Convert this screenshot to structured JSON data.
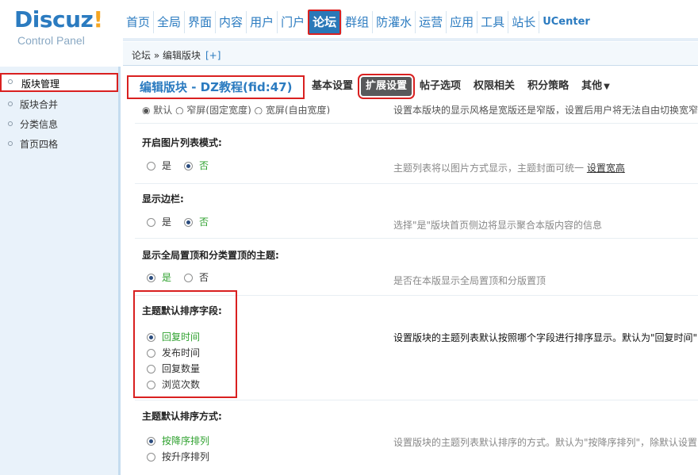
{
  "logo": {
    "brand": "Discuz",
    "bang": "!",
    "sub": "Control Panel"
  },
  "nav": {
    "items": [
      "首页",
      "全局",
      "界面",
      "内容",
      "用户",
      "门户",
      "论坛",
      "群组",
      "防灌水",
      "运营",
      "应用",
      "工具",
      "站长",
      "UCenter"
    ],
    "active_index": 6
  },
  "breadcrumb": {
    "path": "论坛 » 编辑版块",
    "plus": "[+]"
  },
  "sidebar": {
    "items": [
      "版块管理",
      "版块合并",
      "分类信息",
      "首页四格"
    ],
    "active_index": 0
  },
  "page": {
    "title": "编辑版块 - DZ教程(fid:47)",
    "tabs": [
      "基本设置",
      "扩展设置",
      "帖子选项",
      "权限相关",
      "积分策略",
      "其他"
    ],
    "active_tab": 1
  },
  "settings": {
    "partial_top": {
      "text": "◉ 默认    ○ 窄屏(固定宽度)    ○ 宽屏(自由宽度)",
      "desc": "设置本版块的显示风格是宽版还是窄版，设置后用户将无法自由切换宽窄"
    },
    "image_list": {
      "label": "开启图片列表模式:",
      "options": [
        "是",
        "否"
      ],
      "selected": 1,
      "desc": "主题列表将以图片方式显示，主题封面可统一 ",
      "link": "设置宽高"
    },
    "sidebar": {
      "label": "显示边栏:",
      "options": [
        "是",
        "否"
      ],
      "selected": 1,
      "desc": "选择\"是\"版块首页侧边将显示聚合本版内容的信息"
    },
    "global_sticky": {
      "label": "显示全局置顶和分类置顶的主题:",
      "options": [
        "是",
        "否"
      ],
      "selected": 0,
      "desc": "是否在本版显示全局置顶和分版置顶"
    },
    "sort_field": {
      "label": "主题默认排序字段:",
      "options": [
        "回复时间",
        "发布时间",
        "回复数量",
        "浏览次数"
      ],
      "selected": 0,
      "desc": "设置版块的主题列表默认按照哪个字段进行排序显示。默认为\"回复时间\""
    },
    "sort_order": {
      "label": "主题默认排序方式:",
      "options": [
        "按降序排列",
        "按升序排列"
      ],
      "selected": 0,
      "desc": "设置版块的主题列表默认排序的方式。默认为\"按降序排列\"，除默认设置"
    }
  },
  "colors": {
    "accent": "#2b7bc0",
    "highlight": "#d92020",
    "selected_text": "#2fa12f"
  }
}
